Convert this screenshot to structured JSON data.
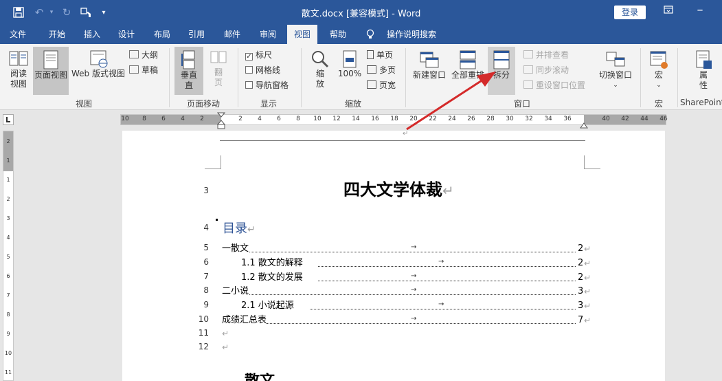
{
  "titlebar": {
    "doc_title": "散文.docx [兼容模式] - Word",
    "login": "登录",
    "save_icon": "save-icon",
    "undo_icon": "undo-icon",
    "redo_icon": "redo-icon"
  },
  "tabs": [
    "文件",
    "开始",
    "插入",
    "设计",
    "布局",
    "引用",
    "邮件",
    "审阅",
    "视图",
    "帮助",
    "操作说明搜索"
  ],
  "active_tab": "视图",
  "ribbon": {
    "views": {
      "read": "阅读\n视图",
      "read1": "阅读",
      "read2": "视图",
      "print": "页面视图",
      "web": "Web 版式视图",
      "outline": "大纲",
      "draft": "草稿",
      "group": "视图"
    },
    "page_move": {
      "vertical1": "垂直",
      "vertical2": "直",
      "flip1": "翻",
      "flip2": "页",
      "group": "页面移动"
    },
    "show": {
      "ruler": "标尺",
      "gridlines": "网格线",
      "nav": "导航窗格",
      "group": "显示"
    },
    "zoom": {
      "zoom1": "缩",
      "zoom2": "放",
      "pct": "100%",
      "one": "单页",
      "multi": "多页",
      "width": "页宽",
      "group": "缩放"
    },
    "window": {
      "new": "新建窗口",
      "arrange": "全部重排",
      "split": "拆分",
      "side": "并排查看",
      "sync": "同步滚动",
      "reset": "重设窗口位置",
      "switch": "切换窗口",
      "group": "窗口"
    },
    "macros": {
      "label": "宏",
      "group": "宏"
    },
    "sharepoint": {
      "label1": "属",
      "label2": "性",
      "group": "SharePoint"
    }
  },
  "ruler_ticks": [
    "10",
    "8",
    "6",
    "4",
    "2",
    "2",
    "4",
    "6",
    "8",
    "10",
    "12",
    "14",
    "16",
    "18",
    "20",
    "22",
    "24",
    "26",
    "28",
    "30",
    "32",
    "34",
    "36",
    "40",
    "42",
    "44",
    "46"
  ],
  "vruler_ticks": [
    "2",
    "1",
    "1",
    "2",
    "3",
    "4",
    "5",
    "6",
    "7",
    "8",
    "9",
    "10",
    "11"
  ],
  "document": {
    "title": "四大文学体裁",
    "toc_title": "目录",
    "toc": [
      {
        "text": "一散文",
        "page": "2",
        "indent": false
      },
      {
        "text": "1.1 散文的解释",
        "page": "2",
        "indent": true
      },
      {
        "text": "1.2 散文的发展",
        "page": "2",
        "indent": true
      },
      {
        "text": "二小说",
        "page": "3",
        "indent": false
      },
      {
        "text": "2.1 小说起源",
        "page": "3",
        "indent": true
      },
      {
        "text": "成绩汇总表",
        "page": "7",
        "indent": false
      }
    ],
    "line_numbers": [
      "3",
      "4",
      "5",
      "6",
      "7",
      "8",
      "9",
      "10",
      "11",
      "12"
    ],
    "return_mark": "↵",
    "heading_partial": "散文"
  },
  "colors": {
    "accent": "#2b579a",
    "arrow": "#d42a2a"
  }
}
